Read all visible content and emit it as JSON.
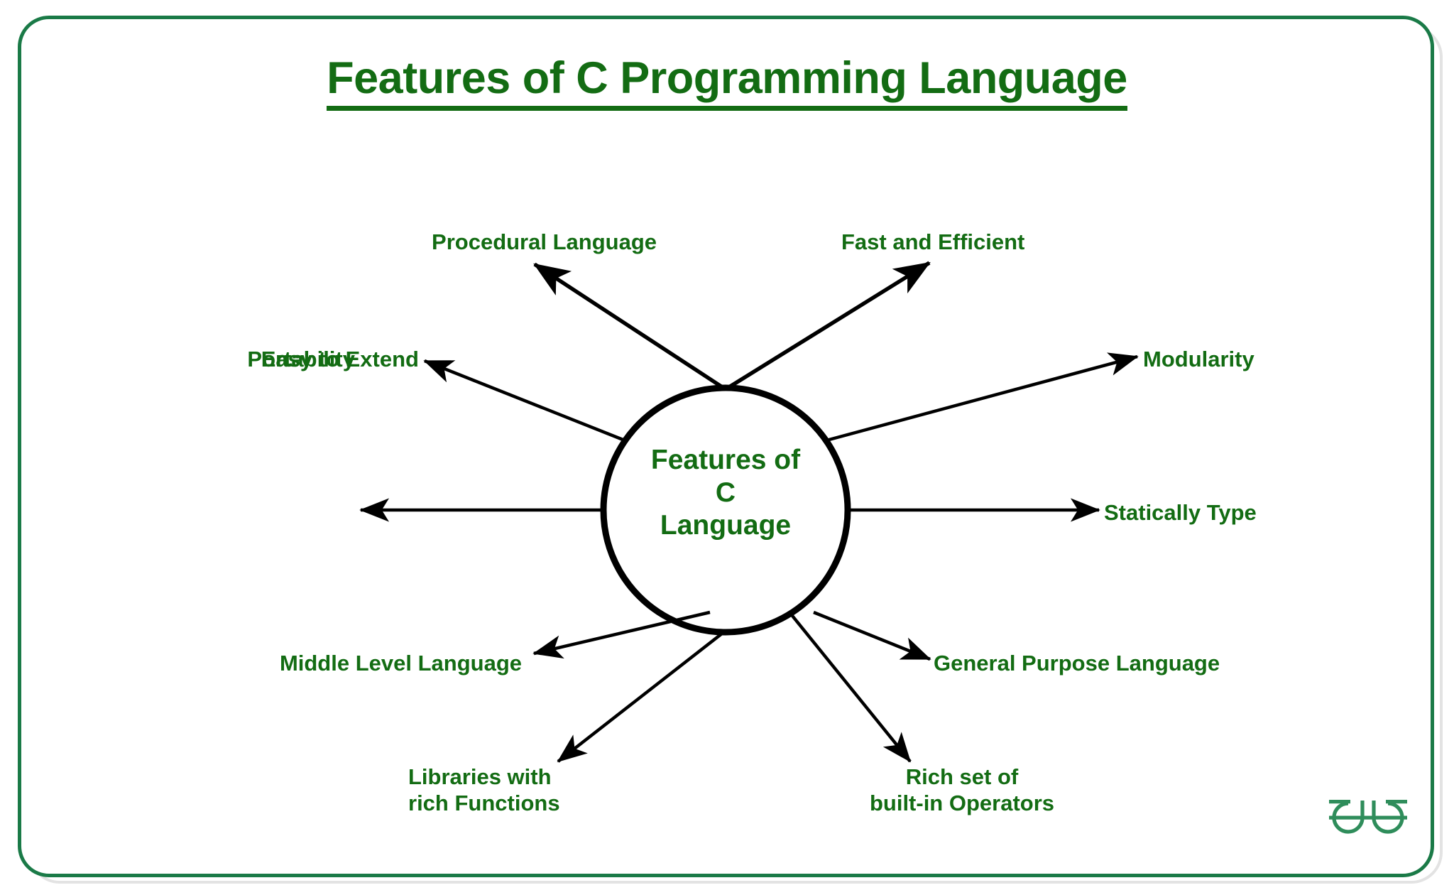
{
  "page": {
    "title": "Features of C Programming Language",
    "accent_green": "#136c13",
    "frame_green": "#1a7a47",
    "logo_green": "#2f8d5b",
    "arrow_color": "#000000",
    "background": "#ffffff"
  },
  "center_node": {
    "line1": "Features of",
    "line2": "C",
    "line3": "Language"
  },
  "nodes": [
    {
      "id": "procedural",
      "label": "Procedural Language",
      "position": "top-left"
    },
    {
      "id": "fast",
      "label": "Fast and Efficient",
      "position": "top-right"
    },
    {
      "id": "easy",
      "label": "Easy to Extend",
      "position": "upper-left"
    },
    {
      "id": "modularity",
      "label": "Modularity",
      "position": "upper-right"
    },
    {
      "id": "portability",
      "label": "Portability",
      "position": "left"
    },
    {
      "id": "statically",
      "label": "Statically Type",
      "position": "right"
    },
    {
      "id": "middle",
      "label": "Middle Level Language",
      "position": "lower-left"
    },
    {
      "id": "general",
      "label": "General Purpose Language",
      "position": "lower-right"
    },
    {
      "id": "libraries",
      "label": "Libraries with\nrich Functions",
      "position": "bottom-left"
    },
    {
      "id": "rich",
      "label": "Rich set of\nbuilt-in Operators",
      "position": "bottom-right"
    }
  ],
  "logo": {
    "name": "geeksforgeeks-logo",
    "text": "GG"
  },
  "chart_data": {
    "type": "diagram",
    "diagram_kind": "mind-map / radial hub-and-spoke",
    "title": "Features of C Programming Language",
    "hub": "Features of C Language",
    "spokes": [
      "Procedural Language",
      "Fast and Efficient",
      "Easy to Extend",
      "Modularity",
      "Portability",
      "Statically Type",
      "Middle Level Language",
      "General Purpose Language",
      "Libraries with rich Functions",
      "Rich set of built-in Operators"
    ],
    "edge_direction": "hub -> spoke (arrowheads at spokes)",
    "spoke_count": 10
  }
}
